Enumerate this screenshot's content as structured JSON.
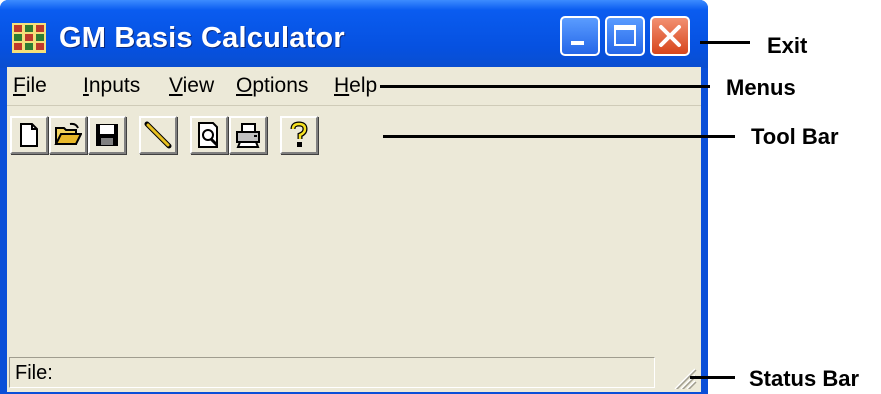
{
  "window": {
    "title": "GM Basis Calculator"
  },
  "title_buttons": [
    "minimize-icon",
    "maximize-icon",
    "close-icon"
  ],
  "menubar": {
    "items": [
      {
        "label": "File"
      },
      {
        "label": "Inputs"
      },
      {
        "label": "View"
      },
      {
        "label": "Options"
      },
      {
        "label": "Help"
      }
    ]
  },
  "toolbar": {
    "buttons": [
      "new-document-icon",
      "open-folder-icon",
      "save-disk-icon",
      "pencil-icon",
      "print-preview-icon",
      "printer-icon",
      "help-question-icon"
    ]
  },
  "statusbar": {
    "text": "File:"
  },
  "annotations": {
    "exit": "Exit",
    "menus": "Menus",
    "toolbar": "Tool Bar",
    "statusbar": "Status Bar"
  },
  "colors": {
    "titlebar": "#0651e0",
    "client": "#ece9d8",
    "close_button": "#d7461c"
  }
}
